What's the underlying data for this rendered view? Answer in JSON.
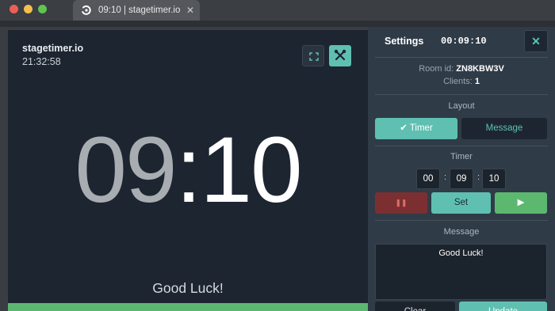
{
  "tab": {
    "title": "09:10 | stagetimer.io",
    "close": "✕"
  },
  "screen": {
    "brand": "stagetimer.io",
    "clock": "21:32:58",
    "timer_minutes": "09",
    "timer_rest": ":10",
    "message": "Good Luck!",
    "progress": 1.0
  },
  "panel": {
    "title": "Settings",
    "time": "00:09:10",
    "close": "✕",
    "room_label": "Room id:",
    "room_id": "ZN8KBW3V",
    "clients_label": "Clients:",
    "clients": "1",
    "layout_label": "Layout",
    "layout_timer": "✔ Timer",
    "layout_message": "Message",
    "timer_label": "Timer",
    "hours": "00",
    "minutes": "09",
    "seconds": "10",
    "colon": ":",
    "stop_icon": "❚❚",
    "set": "Set",
    "play_icon": "▶",
    "message_label": "Message",
    "message_value": "Good Luck!",
    "clear": "Clear",
    "update": "Update"
  },
  "colors": {
    "accent": "#5fc0b2",
    "go": "#5cb870",
    "stop": "#7c2f31",
    "screen_bg": "#1c2530",
    "panel_bg": "#2f3b47"
  }
}
